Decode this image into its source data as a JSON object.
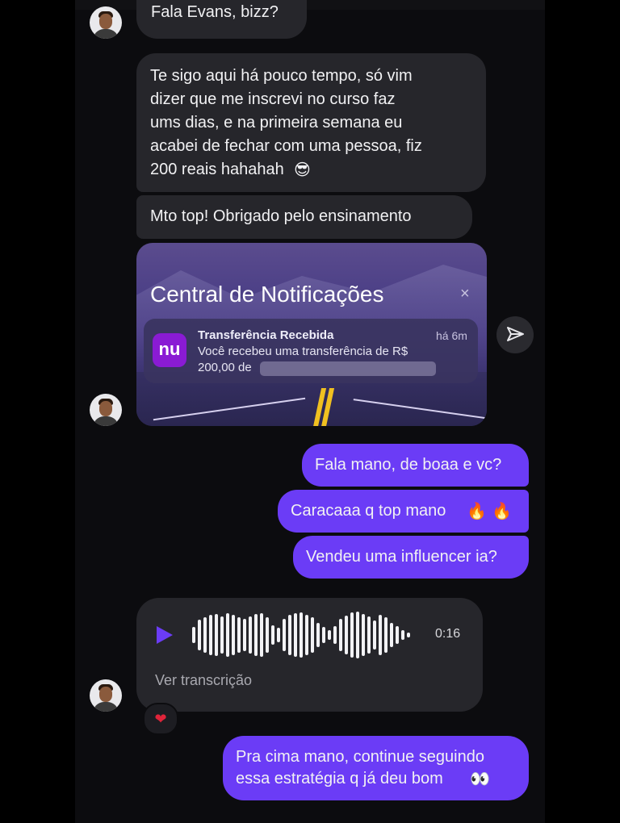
{
  "messages": {
    "m1": "Fala Evans, bizz?",
    "m2_lines": [
      "Te sigo aqui há pouco tempo, só vim",
      "dizer que me inscrevi no curso faz",
      "ums dias, e na primeira semana eu",
      "acabei de fechar com uma pessoa, fiz",
      "200 reais hahahah"
    ],
    "m2_emoji": "😎",
    "m3": "Mto top! Obrigado pelo ensinamento",
    "o1": "Fala mano, de boaa e vc?",
    "o2": "Caracaaa q top mano",
    "o2_emoji": "🔥 🔥",
    "o3": "Vendeu uma influencer ia?",
    "o4_line1": "Pra cima mano, continue seguindo",
    "o4_line2": "essa estratégia q já deu bom",
    "o4_emoji": "👀"
  },
  "notification_card": {
    "title": "Central de Notificações",
    "close_icon": "×",
    "app_logo": "nu",
    "notif_title": "Transferência Recebida",
    "notif_time": "há 6m",
    "notif_body_line1": "Você recebeu uma transferência de R$",
    "notif_body_line2": "200,00 de"
  },
  "audio": {
    "duration": "0:16",
    "transcription_label": "Ver transcrição",
    "reaction": "❤"
  },
  "colors": {
    "incoming_bubble": "#26262b",
    "outgoing_bubble": "#6b3cf6",
    "background": "#0c0c0f"
  },
  "icons": {
    "share": "paper-plane-icon",
    "play": "play-icon",
    "reaction": "heart-icon"
  }
}
